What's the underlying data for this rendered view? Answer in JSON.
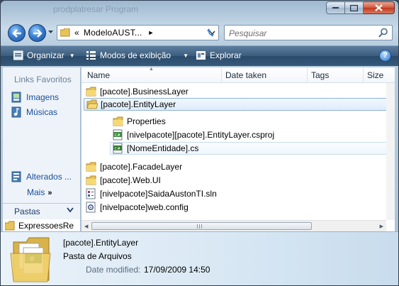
{
  "window": {
    "title": "prodplatresar Program"
  },
  "nav": {
    "address_prefix": "«",
    "address_text": "ModeloAUST...",
    "address_sep": "►",
    "search_placeholder": "Pesquisar"
  },
  "toolbar": {
    "organize": "Organizar",
    "views": "Modos de exibição",
    "explore": "Explorar",
    "help": "?"
  },
  "sidebar": {
    "favorites_title": "Links Favoritos",
    "items": [
      {
        "label": "Imagens",
        "icon": "pictures-icon"
      },
      {
        "label": "Músicas",
        "icon": "music-icon"
      },
      {
        "label": "Alterados ...",
        "icon": "recent-icon"
      }
    ],
    "more": "Mais",
    "more_chevron": "»",
    "folders_label": "Pastas",
    "tree_item": "ExpressoesRe"
  },
  "columns": [
    "Name",
    "Date taken",
    "Tags",
    "Size"
  ],
  "files": [
    {
      "name": "[pacote].BusinessLayer",
      "icon": "folder-icon",
      "indent": 0
    },
    {
      "name": "[pacote].EntityLayer",
      "icon": "folder-open-icon",
      "indent": 0,
      "state": "selected"
    },
    {
      "name": "Properties",
      "icon": "folder-icon",
      "indent": 1
    },
    {
      "name": "[nivelpacote][pacote].EntityLayer.csproj",
      "icon": "csproj-icon",
      "indent": 1
    },
    {
      "name": "[NomeEntidade].cs",
      "icon": "csharp-file-icon",
      "indent": 1,
      "state": "hover"
    },
    {
      "name": "[pacote].FacadeLayer",
      "icon": "folder-icon",
      "indent": 0
    },
    {
      "name": "[pacote].Web.UI",
      "icon": "folder-icon",
      "indent": 0
    },
    {
      "name": "[nivelpacote]SaidaAustonTI.sln",
      "icon": "solution-icon",
      "indent": 0
    },
    {
      "name": "[nivelpacote]web.config",
      "icon": "config-icon",
      "indent": 0
    }
  ],
  "details": {
    "name": "[pacote].EntityLayer",
    "type": "Pasta de Arquivos",
    "modified_label": "Date modified:",
    "modified_value": "17/09/2009 14:50"
  }
}
